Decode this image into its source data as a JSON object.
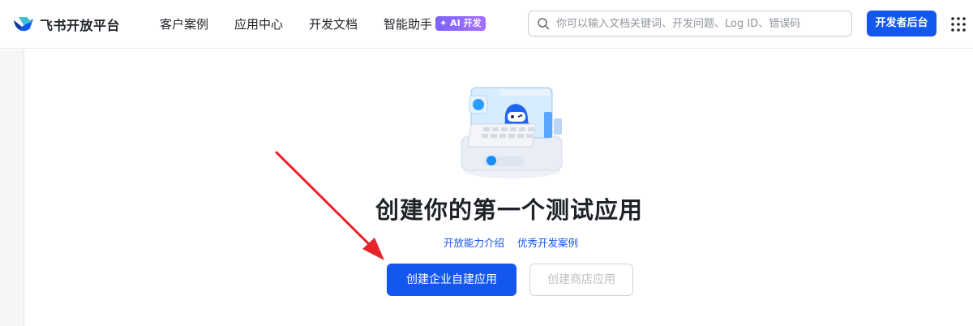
{
  "header": {
    "logo_text": "飞书开放平台",
    "nav": [
      {
        "label": "客户案例"
      },
      {
        "label": "应用中心"
      },
      {
        "label": "开发文档"
      },
      {
        "label": "智能助手",
        "badge": "✦ AI 开发"
      }
    ],
    "search": {
      "placeholder": "你可以输入文档关键词、开发问题、Log ID、错误码",
      "icon": "search-icon"
    },
    "dev_console_label": "开发者后台",
    "apps_icon": "grid-icon"
  },
  "main": {
    "title": "创建你的第一个测试应用",
    "links": [
      {
        "label": "开放能力介绍"
      },
      {
        "label": "优秀开发案例"
      }
    ],
    "primary_button": "创建企业自建应用",
    "secondary_button": "创建商店应用",
    "secondary_disabled": true
  },
  "colors": {
    "accent": "#1456f0",
    "annotation_arrow": "#e8232a",
    "ai_badge": "#8b67ff"
  }
}
